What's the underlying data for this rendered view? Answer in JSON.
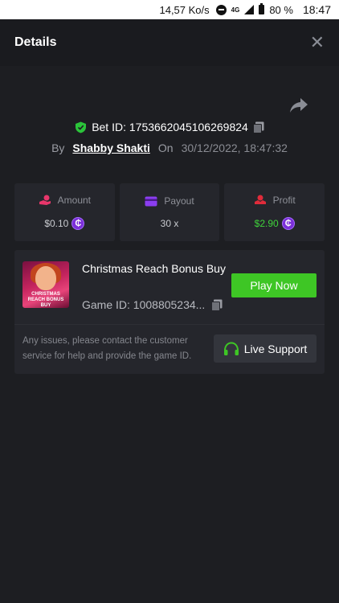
{
  "status_bar": {
    "speed": "14,57 Ko/s",
    "network": "4G",
    "battery": "80 %",
    "time": "18:47"
  },
  "header": {
    "title": "Details",
    "close_icon": "close-icon"
  },
  "bet": {
    "label": "Bet ID: 1753662045106269824",
    "by_label": "By",
    "user": "Shabby Shakti",
    "on_label": "On",
    "date": "30/12/2022, 18:47:32"
  },
  "stats": {
    "amount": {
      "label": "Amount",
      "value": "$0.10",
      "icon": "bet-hand-icon"
    },
    "payout": {
      "label": "Payout",
      "value": "30 x",
      "icon": "wallet-card-icon"
    },
    "profit": {
      "label": "Profit",
      "value": "$2.90",
      "icon": "profit-hand-icon"
    }
  },
  "coin_symbol": "₵",
  "game": {
    "name": "Christmas Reach Bonus Buy",
    "id": "Game ID: 1008805234...",
    "thumb_text": "CHRISTMAS REACH BONUS BUY",
    "play_label": "Play Now",
    "support_text": "Any issues, please contact the customer service for help and provide the game ID.",
    "live_support_label": "Live Support"
  },
  "colors": {
    "accent_green": "#3ec625",
    "profit_green": "#3fd33b",
    "coin_purple": "#7b2fd9",
    "bg": "#1d1e22",
    "card": "#25262c"
  }
}
